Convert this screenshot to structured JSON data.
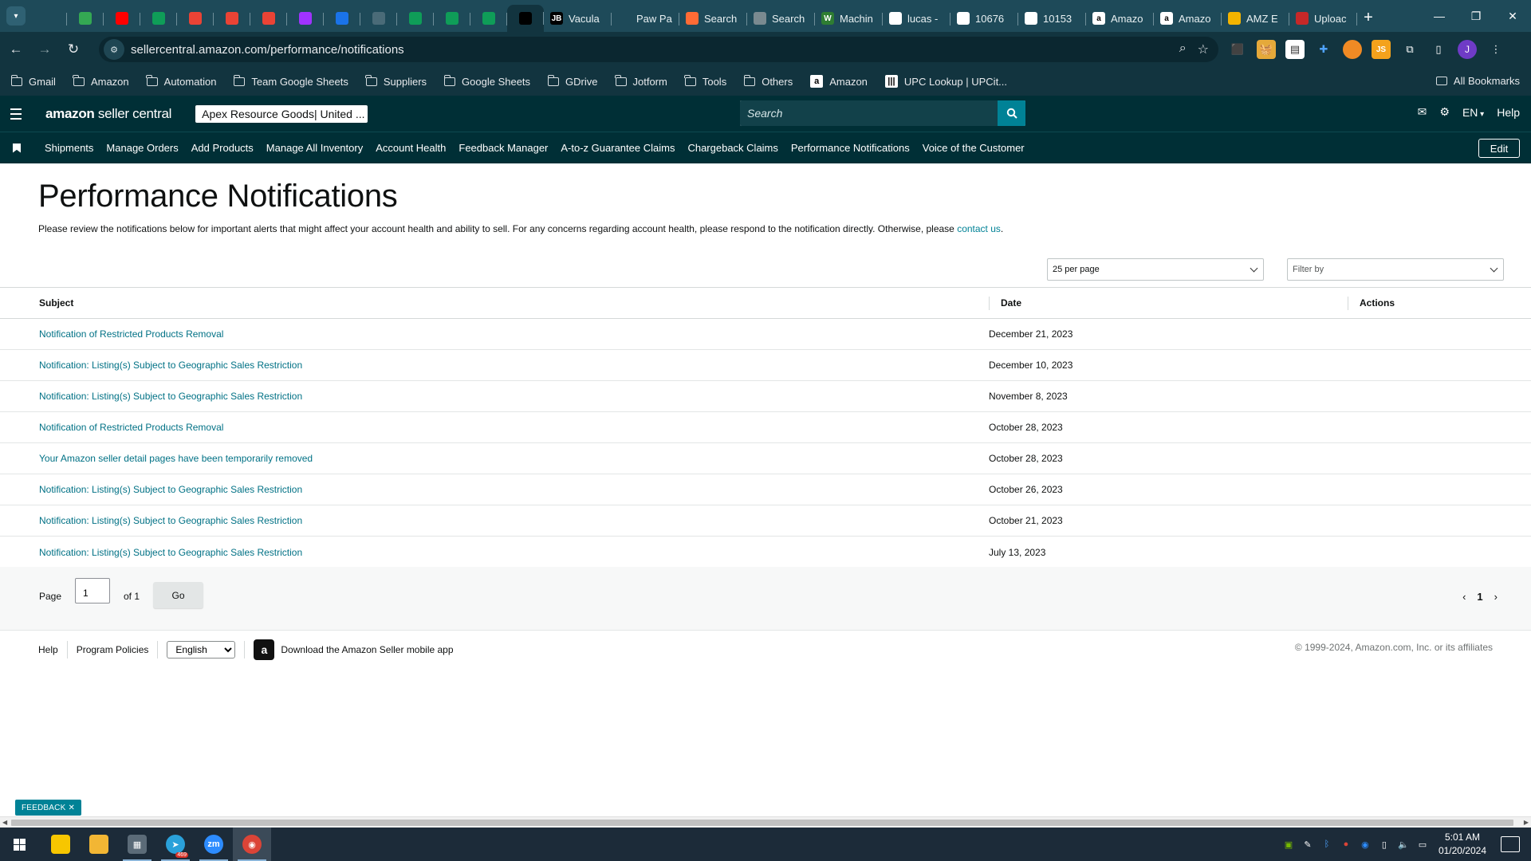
{
  "browser": {
    "pinned_tabs": [
      {
        "icon": "telegram-icon",
        "color": "#1e4a59"
      },
      {
        "icon": "sheets-icon",
        "color": "#34a853"
      },
      {
        "icon": "youtube-icon",
        "color": "#ff0000"
      },
      {
        "icon": "sheets-icon",
        "color": "#0f9d58"
      },
      {
        "icon": "gmail-icon",
        "color": "#ea4335"
      },
      {
        "icon": "gmail-icon",
        "color": "#ea4335"
      },
      {
        "icon": "gmail-icon",
        "color": "#ea4335"
      },
      {
        "icon": "messenger-icon",
        "color": "#a033ff"
      },
      {
        "icon": "number-2-icon",
        "color": "#1a73e8"
      },
      {
        "icon": "chart-icon",
        "color": "#4a6b78"
      },
      {
        "icon": "sheets-icon",
        "color": "#0f9d58"
      },
      {
        "icon": "sheets-icon",
        "color": "#0f9d58"
      },
      {
        "icon": "sheets-icon",
        "color": "#0f9d58"
      },
      {
        "icon": "amazon-icon",
        "color": "#000000"
      }
    ],
    "titled_tabs": [
      {
        "title": "Vacula",
        "icon": "jetbrains-icon",
        "fav_text": "JB",
        "color": "#000000"
      },
      {
        "title": "Paw Pa",
        "icon": "loading-icon",
        "fav_text": "",
        "color": "#1e4a59"
      },
      {
        "title": "Search",
        "icon": "search-site-icon",
        "fav_text": "",
        "color": "#ff6b35"
      },
      {
        "title": "Search",
        "icon": "search-site-icon",
        "fav_text": "",
        "color": "#7a8a90"
      },
      {
        "title": "Machin",
        "icon": "w-icon",
        "fav_text": "W",
        "color": "#2e7d32"
      },
      {
        "title": "lucas -",
        "icon": "doc-icon",
        "fav_text": "",
        "color": "#ffffff"
      },
      {
        "title": "10676",
        "icon": "doc-icon",
        "fav_text": "",
        "color": "#ffffff"
      },
      {
        "title": "10153",
        "icon": "doc-icon",
        "fav_text": "",
        "color": "#ffffff"
      },
      {
        "title": "Amazo",
        "icon": "amazon-icon",
        "fav_text": "a",
        "color": "#ffffff"
      },
      {
        "title": "Amazo",
        "icon": "amazon-icon",
        "fav_text": "a",
        "color": "#ffffff"
      },
      {
        "title": "AMZ E",
        "icon": "pencil-icon",
        "fav_text": "",
        "color": "#f4b400"
      },
      {
        "title": "Uploac",
        "icon": "shield-icon",
        "fav_text": "",
        "color": "#c62828"
      }
    ],
    "url": "sellercentral.amazon.com/performance/notifications",
    "bookmarks": [
      {
        "label": "Gmail",
        "type": "folder"
      },
      {
        "label": "Amazon",
        "type": "folder"
      },
      {
        "label": "Automation",
        "type": "folder"
      },
      {
        "label": "Team Google Sheets",
        "type": "folder"
      },
      {
        "label": "Suppliers",
        "type": "folder"
      },
      {
        "label": "Google Sheets",
        "type": "folder"
      },
      {
        "label": "GDrive",
        "type": "folder"
      },
      {
        "label": "Jotform",
        "type": "folder"
      },
      {
        "label": "Tools",
        "type": "folder"
      },
      {
        "label": "Others",
        "type": "folder"
      },
      {
        "label": "Amazon",
        "type": "site"
      },
      {
        "label": "UPC Lookup | UPCit...",
        "type": "site"
      }
    ],
    "all_bookmarks": "All Bookmarks",
    "profile_initial": "J"
  },
  "header": {
    "logo_bold": "amazon",
    "logo_rest": " seller central",
    "store": "Apex Resource Goods",
    "store_region": " | United ...",
    "search_placeholder": "Search",
    "lang": "EN",
    "help": "Help"
  },
  "nav": {
    "links": [
      "Shipments",
      "Manage Orders",
      "Add Products",
      "Manage All Inventory",
      "Account Health",
      "Feedback Manager",
      "A-to-z Guarantee Claims",
      "Chargeback Claims",
      "Performance Notifications",
      "Voice of the Customer"
    ],
    "edit": "Edit"
  },
  "page": {
    "title": "Performance Notifications",
    "description": "Please review the notifications below for important alerts that might affect your account health and ability to sell. For any concerns regarding account health, please respond to the notification directly. Otherwise, please ",
    "contact_link": "contact us",
    "description_end": ".",
    "per_page": "25 per page",
    "filter_placeholder": "Filter by"
  },
  "table": {
    "headers": {
      "subject": "Subject",
      "date": "Date",
      "actions": "Actions"
    },
    "rows": [
      {
        "subject": "Notification of Restricted Products Removal",
        "date": "December 21, 2023"
      },
      {
        "subject": "Notification: Listing(s) Subject to Geographic Sales Restriction",
        "date": "December 10, 2023"
      },
      {
        "subject": "Notification: Listing(s) Subject to Geographic Sales Restriction",
        "date": "November 8, 2023"
      },
      {
        "subject": "Notification of Restricted Products Removal",
        "date": "October 28, 2023"
      },
      {
        "subject": "Your Amazon seller detail pages have been temporarily removed",
        "date": "October 28, 2023"
      },
      {
        "subject": "Notification: Listing(s) Subject to Geographic Sales Restriction",
        "date": "October 26, 2023"
      },
      {
        "subject": "Notification: Listing(s) Subject to Geographic Sales Restriction",
        "date": "October 21, 2023"
      },
      {
        "subject": "Notification: Listing(s) Subject to Geographic Sales Restriction",
        "date": "July 13, 2023"
      }
    ]
  },
  "pager": {
    "page_label": "Page",
    "page_value": "1",
    "of_label": "of 1",
    "go": "Go",
    "current": "1"
  },
  "footer": {
    "help": "Help",
    "policies": "Program Policies",
    "language": "English",
    "app_text": "Download the Amazon Seller mobile app",
    "copyright": "© 1999-2024, Amazon.com, Inc. or its affiliates"
  },
  "feedback": "FEEDBACK",
  "taskbar": {
    "apps": [
      {
        "icon": "sticky-notes-icon",
        "color": "#f7c600",
        "open": false
      },
      {
        "icon": "file-explorer-icon",
        "color": "#f2b634",
        "open": false
      },
      {
        "icon": "calculator-icon",
        "color": "#5b6b78",
        "open": true
      },
      {
        "icon": "telegram-icon",
        "color": "#2aa1da",
        "open": true,
        "badge": "469"
      },
      {
        "icon": "zoom-icon",
        "color": "#2d8cff",
        "open": true
      },
      {
        "icon": "chrome-icon",
        "color": "#db4437",
        "open": true
      }
    ],
    "time": "5:01 AM",
    "date": "01/20/2024"
  },
  "colors": {
    "header_bg": "#002f36",
    "link": "#007185",
    "accent": "#008296"
  }
}
